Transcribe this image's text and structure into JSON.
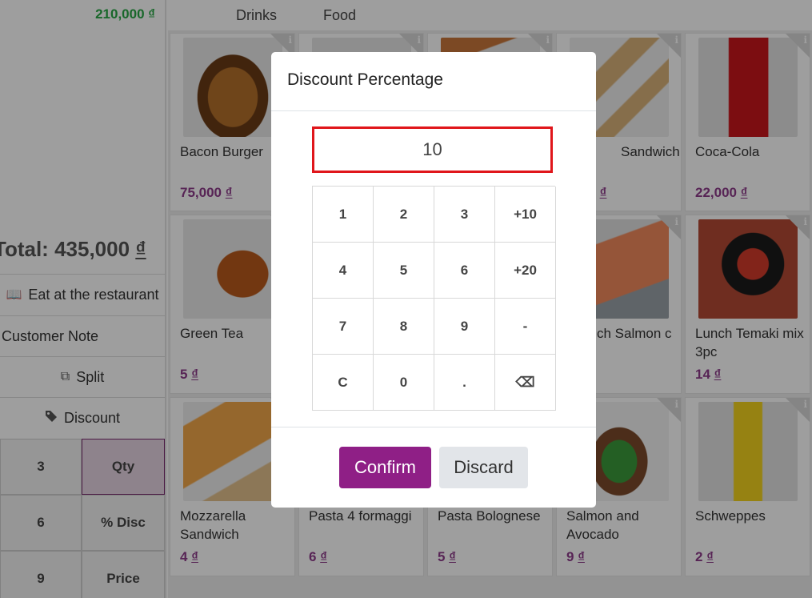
{
  "order": {
    "line_price": "210,000 ₫",
    "total_label": "Total:",
    "total_amount": "435,000",
    "total_currency": "₫"
  },
  "controls": {
    "eat_in": "Eat at the restaurant",
    "customer_note": "Customer Note",
    "split": "Split",
    "discount": "Discount"
  },
  "side_numpad": {
    "keys": [
      "3",
      "Qty",
      "6",
      "% Disc",
      "9",
      "Price"
    ],
    "active": "Qty"
  },
  "categories": [
    "Drinks",
    "Food"
  ],
  "products": [
    {
      "name": "Bacon Burger",
      "price": "75,000",
      "cur": "₫"
    },
    {
      "name": "",
      "price": "",
      "cur": ""
    },
    {
      "name": "",
      "price": "",
      "cur": ""
    },
    {
      "name": "Sandwich",
      "price": "00",
      "cur": "₫"
    },
    {
      "name": "Coca-Cola",
      "price": "22,000",
      "cur": "₫"
    },
    {
      "name": "Green Tea",
      "price": "5",
      "cur": "₫"
    },
    {
      "name": "",
      "price": "",
      "cur": ""
    },
    {
      "name": "",
      "price": "",
      "cur": ""
    },
    {
      "name": "ch Salmon c",
      "price": "",
      "cur": ""
    },
    {
      "name": "Lunch Temaki mix 3pc",
      "price": "14",
      "cur": "₫"
    },
    {
      "name": "Mozzarella Sandwich",
      "price": "4",
      "cur": "₫"
    },
    {
      "name": "Pasta 4 formaggi",
      "price": "6",
      "cur": "₫"
    },
    {
      "name": "Pasta Bolognese",
      "price": "5",
      "cur": "₫"
    },
    {
      "name": "Salmon and Avocado",
      "price": "9",
      "cur": "₫"
    },
    {
      "name": "Schweppes",
      "price": "2",
      "cur": "₫"
    }
  ],
  "info_icon": "i",
  "dialog": {
    "title": "Discount Percentage",
    "input_value": "10",
    "keys": [
      "1",
      "2",
      "3",
      "+10",
      "4",
      "5",
      "6",
      "+20",
      "7",
      "8",
      "9",
      "-",
      "C",
      "0",
      ".",
      "⌫"
    ],
    "confirm_label": "Confirm",
    "discard_label": "Discard"
  },
  "colors": {
    "accent": "#8f1f86",
    "price": "#8d3a8a",
    "positive": "#28a745",
    "input_border": "#e0161b"
  }
}
